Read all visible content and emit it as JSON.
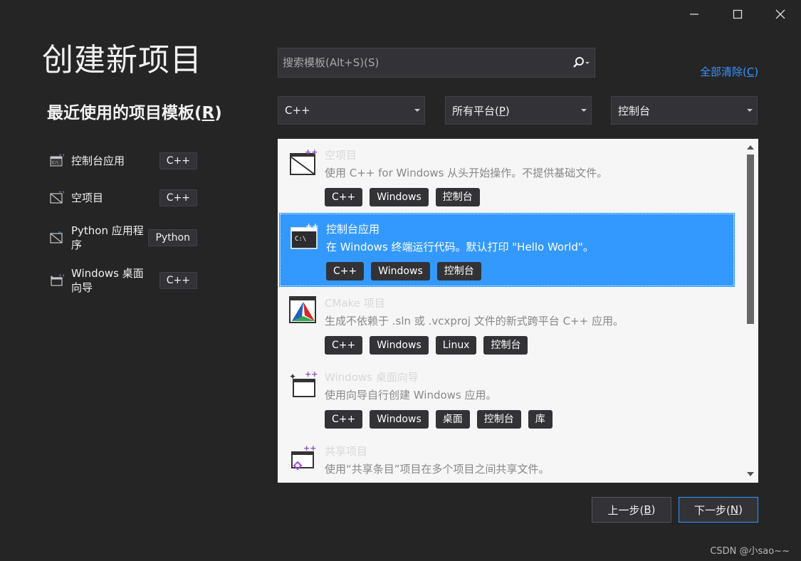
{
  "window": {
    "controls": [
      {
        "name": "minimize-button",
        "icon": "minimize-icon"
      },
      {
        "name": "maximize-button",
        "icon": "maximize-icon"
      },
      {
        "name": "close-button",
        "icon": "close-icon"
      }
    ]
  },
  "page_title": "创建新项目",
  "recent": {
    "heading": "最近使用的项目模板(",
    "heading_key": "R",
    "heading_end": ")",
    "items": [
      {
        "label": "控制台应用",
        "badge": "C++",
        "icon": "console-app-icon"
      },
      {
        "label": "空项目",
        "badge": "C++",
        "icon": "empty-project-icon"
      },
      {
        "label": "Python 应用程序",
        "badge": "Python",
        "icon": "python-app-icon"
      },
      {
        "label": "Windows 桌面向导",
        "badge": "C++",
        "icon": "windows-wizard-icon"
      }
    ]
  },
  "search": {
    "placeholder": "搜索模板(Alt+S)(S)",
    "icon": "search-icon"
  },
  "clear_all": {
    "label": "全部清除(",
    "key": "C",
    "end": ")"
  },
  "filters": {
    "language": "C++",
    "platform_prefix": "所有平台(",
    "platform_key": "P",
    "platform_end": ")",
    "project_type": "控制台"
  },
  "templates": [
    {
      "title": "空项目",
      "description": "使用 C++ for Windows 从头开始操作。不提供基础文件。",
      "tags": [
        "C++",
        "Windows",
        "控制台"
      ],
      "icon": "empty-project-icon",
      "selected": false
    },
    {
      "title": "控制台应用",
      "description": "在 Windows 终端运行代码。默认打印 \"Hello World\"。",
      "tags": [
        "C++",
        "Windows",
        "控制台"
      ],
      "icon": "console-app-icon",
      "selected": true
    },
    {
      "title": "CMake 项目",
      "description": "生成不依赖于 .sln 或 .vcxproj 文件的新式跨平台 C++ 应用。",
      "tags": [
        "C++",
        "Windows",
        "Linux",
        "控制台"
      ],
      "icon": "cmake-icon",
      "selected": false
    },
    {
      "title": "Windows 桌面向导",
      "description": "使用向导自行创建 Windows 应用。",
      "tags": [
        "C++",
        "Windows",
        "桌面",
        "控制台",
        "库"
      ],
      "icon": "windows-wizard-icon",
      "selected": false
    },
    {
      "title": "共享项目",
      "description": "使用“共享条目”项目在多个项目之间共享文件。",
      "tags": [],
      "icon": "shared-project-icon",
      "selected": false
    }
  ],
  "buttons": {
    "prev_prefix": "上一步(",
    "prev_key": "B",
    "prev_end": ")",
    "next_prefix": "下一步(",
    "next_key": "N",
    "next_end": ")"
  },
  "watermark": "CSDN @小sao~~",
  "colors": {
    "background": "#252526",
    "accent": "#3399ff",
    "link": "#3794ff",
    "panel": "#f6f6f6",
    "tag": "#333337"
  }
}
